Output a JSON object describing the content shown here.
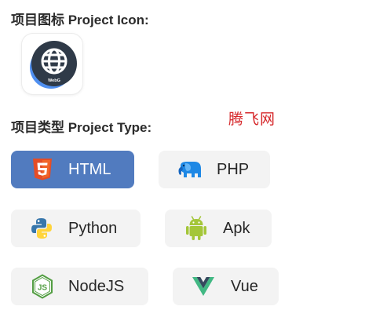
{
  "project_icon": {
    "heading": "项目图标 Project Icon:",
    "icon_name": "globe-app-icon",
    "icon_caption": "WebG"
  },
  "watermark": "腾飞网",
  "project_type": {
    "heading": "项目类型 Project Type:",
    "selected": "HTML",
    "options": [
      {
        "label": "HTML",
        "icon": "html5-icon",
        "color": "#e44d26"
      },
      {
        "label": "PHP",
        "icon": "php-elephant-icon",
        "color": "#1e88e5"
      },
      {
        "label": "Python",
        "icon": "python-icon",
        "color": "#3776ab"
      },
      {
        "label": "Apk",
        "icon": "android-icon",
        "color": "#a4c639"
      },
      {
        "label": "NodeJS",
        "icon": "nodejs-icon",
        "color": "#539e43"
      },
      {
        "label": "Vue",
        "icon": "vue-icon",
        "color": "#41b883"
      }
    ]
  },
  "colors": {
    "selected_bg": "#517bbf",
    "unselected_bg": "#f3f3f3",
    "watermark": "#d6282b"
  }
}
